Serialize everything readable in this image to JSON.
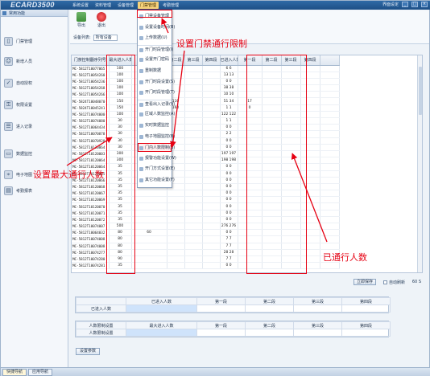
{
  "app": {
    "logo": "ECARD3500",
    "menu": [
      "系统设置",
      "资料管理",
      "设备管理",
      "门禁管理",
      "考勤管理"
    ],
    "menu_active_index": 3,
    "window_caption": "界面设定",
    "win_buttons": [
      "_",
      "□",
      "×"
    ]
  },
  "sidebar": {
    "title": "常用功能",
    "items": [
      {
        "label": "门禁管理",
        "icon": "door-icon"
      },
      {
        "label": "新增人员",
        "icon": "user-add-icon"
      },
      {
        "label": "自动授权",
        "icon": "auth-icon"
      },
      {
        "label": "权限设置",
        "icon": "permission-icon"
      },
      {
        "label": "进入记录",
        "icon": "record-icon"
      },
      {
        "label": "数据监控",
        "icon": "monitor-icon"
      },
      {
        "label": "电子地图",
        "icon": "map-icon"
      },
      {
        "label": "考勤报表",
        "icon": "report-icon"
      }
    ]
  },
  "toolbar": {
    "export_label": "导出",
    "exit_label": "退出",
    "filter_label": "设备列表:",
    "filter_value": "所有设备"
  },
  "dropdown": {
    "items": [
      "门禁设备管理",
      "设置设备时间(B)",
      "上传数据(U)",
      "开门时段管理(I)",
      "设置开门密码",
      "重制数据",
      "开门时段设置(S)",
      "开门时段管理(T)",
      "查看出入记录(V)",
      "区域人数监控(A)",
      "实时数据监控",
      "电子地图监控(B)",
      "门内人数限制(B)",
      "报警功能设置(W)",
      "开门方式设置(E)",
      "其它功能设置(F)"
    ],
    "highlight_index": 12
  },
  "grid": {
    "columns": [
      "门禁控制器序列号",
      "最大进入人数",
      "第一段",
      "第二段",
      "第三段",
      "第四段",
      "已进入人数",
      "第一段",
      "第二段",
      "第三段",
      "第四段"
    ],
    "rows": [
      [
        "MC-5812T10077065",
        "100",
        "",
        "",
        "",
        "",
        "6 6",
        "",
        "",
        "",
        ""
      ],
      [
        "MC-5812T10054260",
        "100",
        "",
        "",
        "",
        "",
        "13 13",
        "",
        "",
        "",
        ""
      ],
      [
        "MC-5812T10054236",
        "100",
        "",
        "",
        "",
        "",
        "0 0",
        "",
        "",
        "",
        ""
      ],
      [
        "MC-5812T10054268",
        "100",
        "",
        "",
        "",
        "",
        "38 38",
        "",
        "",
        "",
        ""
      ],
      [
        "MC-5812T10054266",
        "100",
        "",
        "",
        "",
        "",
        "10 10",
        "",
        "",
        "",
        ""
      ],
      [
        "MC-5824T10048070",
        "150",
        "50",
        "110",
        "",
        "",
        "51 34",
        "17",
        "",
        "",
        ""
      ],
      [
        "MC-5824T10045241",
        "150",
        "50",
        "160",
        "",
        "",
        "1 1",
        "0",
        "",
        "",
        ""
      ],
      [
        "MC-5812T10074000",
        "100",
        "",
        "",
        "",
        "",
        "122 122",
        "",
        "",
        "",
        ""
      ],
      [
        "MC-5812T10074080",
        "30",
        "",
        "",
        "",
        "",
        "1 1",
        "",
        "",
        "",
        ""
      ],
      [
        "MC-5812T10064434",
        "30",
        "",
        "",
        "",
        "",
        "0 0",
        "",
        "",
        "",
        ""
      ],
      [
        "MC-5812T10070878",
        "30",
        "",
        "",
        "",
        "",
        "2 2",
        "",
        "",
        "",
        ""
      ],
      [
        "MC-5812T10070920",
        "30",
        "",
        "",
        "",
        "",
        "0 0",
        "",
        "",
        "",
        ""
      ],
      [
        "MC-5812T10120064",
        "30",
        "",
        "",
        "",
        "",
        "0 0",
        "",
        "",
        "",
        ""
      ],
      [
        "MC-5812T10120003",
        "300",
        "",
        "",
        "",
        "",
        "197 197",
        "",
        "",
        "",
        ""
      ],
      [
        "MC-5812T10120064",
        "300",
        "",
        "",
        "",
        "",
        "198 198",
        "",
        "",
        "",
        ""
      ],
      [
        "MC-5812T10120064",
        "35",
        "",
        "",
        "",
        "",
        "0 0",
        "",
        "",
        "",
        ""
      ],
      [
        "MC-5812T10120065",
        "35",
        "",
        "",
        "",
        "",
        "0 0",
        "",
        "",
        "",
        ""
      ],
      [
        "MC-5812T10120066",
        "35",
        "",
        "",
        "",
        "",
        "0 0",
        "",
        "",
        "",
        ""
      ],
      [
        "MC-5812T10120068",
        "35",
        "",
        "",
        "",
        "",
        "0 0",
        "",
        "",
        "",
        ""
      ],
      [
        "MC-5812T10120067",
        "35",
        "",
        "",
        "",
        "",
        "0 0",
        "",
        "",
        "",
        ""
      ],
      [
        "MC-5812T10120069",
        "35",
        "",
        "",
        "",
        "",
        "0 0",
        "",
        "",
        "",
        ""
      ],
      [
        "MC-5812T10120070",
        "35",
        "",
        "",
        "",
        "",
        "0 0",
        "",
        "",
        "",
        ""
      ],
      [
        "MC-5812T10120071",
        "35",
        "",
        "",
        "",
        "",
        "0 0",
        "",
        "",
        "",
        ""
      ],
      [
        "MC-5812T10120072",
        "35",
        "",
        "",
        "",
        "",
        "0 0",
        "",
        "",
        "",
        ""
      ],
      [
        "MC-5812T10074007",
        "500",
        "",
        "",
        "",
        "",
        "276 276",
        "",
        "",
        "",
        ""
      ],
      [
        "MC-5812T10064032",
        "80",
        "60",
        "",
        "",
        "",
        "0 0",
        "",
        "",
        "",
        ""
      ],
      [
        "MC-5812T10074008",
        "80",
        "",
        "",
        "",
        "",
        "7 7",
        "",
        "",
        "",
        ""
      ],
      [
        "MC-5812T10074008",
        "80",
        "",
        "",
        "",
        "",
        "7 7",
        "",
        "",
        "",
        ""
      ],
      [
        "MC-5812T10074277",
        "80",
        "",
        "",
        "",
        "",
        "28 28",
        "",
        "",
        "",
        ""
      ],
      [
        "MC-5812T10074280",
        "90",
        "",
        "",
        "",
        "",
        "7 7",
        "",
        "",
        "",
        ""
      ],
      [
        "MC-5812T10074281",
        "35",
        "",
        "",
        "",
        "",
        "0 0",
        "",
        "",
        "",
        ""
      ]
    ]
  },
  "actions": {
    "save_label": "立即保存",
    "auto_refresh_label": "自动刷新",
    "refresh_value": "60",
    "refresh_unit": "S"
  },
  "form_entered": {
    "header": [
      "",
      "已进入人数",
      "第一段",
      "第二段",
      "第三段",
      "第四段"
    ],
    "row_label": "已进入人数"
  },
  "form_limit": {
    "header": [
      "人数限制设置",
      "最大进入人数",
      "第一段",
      "第二段",
      "第三段",
      "第四段"
    ],
    "row_label": "人数限制设置"
  },
  "set_param_label": "设置参数",
  "taskbar": {
    "items": [
      "快捷导航",
      "应用导航"
    ],
    "active_index": 0
  },
  "annotations": {
    "gate_limit": "设置门禁通行限制",
    "max_count": "设置最大通行人数",
    "passed_count": "已通行人数",
    "color": "#e60012"
  }
}
